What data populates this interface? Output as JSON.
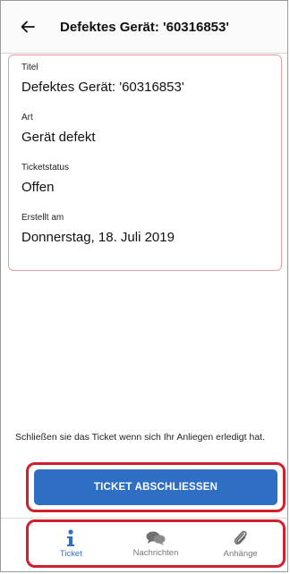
{
  "app_bar": {
    "title": "Defektes Gerät: '60316853'",
    "back_icon": "arrow-left-icon"
  },
  "form": {
    "fields": [
      {
        "label": "Titel",
        "value": "Defektes Gerät: '60316853'"
      },
      {
        "label": "Art",
        "value": "Gerät defekt"
      },
      {
        "label": "Ticketstatus",
        "value": "Offen"
      },
      {
        "label": "Erstellt am",
        "value": "Donnerstag, 18. Juli 2019"
      }
    ]
  },
  "hint_text": "Schließen sie das Ticket wenn sich Ihr Anliegen erledigt hat.",
  "close_button_label": "TICKET ABSCHLIESSEN",
  "tabs": [
    {
      "label": "Ticket",
      "icon": "info-icon",
      "active": true
    },
    {
      "label": "Nachrichten",
      "icon": "chat-bubbles-icon",
      "active": false
    },
    {
      "label": "Anhänge",
      "icon": "paperclip-icon",
      "active": false
    }
  ],
  "colors": {
    "accent": "#2f6fc3",
    "highlight": "#d11f2c",
    "inactive": "#777777"
  }
}
